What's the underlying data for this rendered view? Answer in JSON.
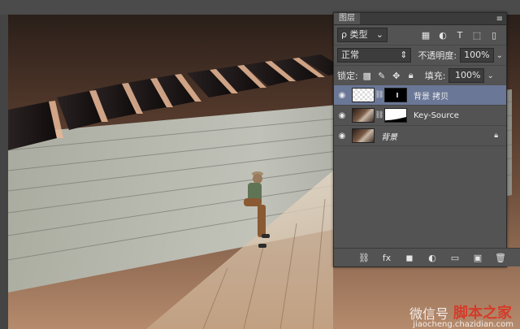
{
  "panel": {
    "tab_label": "图层",
    "menu_glyph": "≡",
    "filter": {
      "kind_label": "ρ 类型"
    },
    "blend": {
      "mode": "正常",
      "opacity_label": "不透明度:",
      "opacity_value": "100%"
    },
    "lock": {
      "label": "锁定:",
      "fill_label": "填充:",
      "fill_value": "100%"
    },
    "layers": [
      {
        "name": "背景 拷贝",
        "active": true
      },
      {
        "name": "Key-Source",
        "active": false
      },
      {
        "name": "背景",
        "active": false
      }
    ]
  },
  "watermark": {
    "left_text": "微信号",
    "right_text": "脚本之家",
    "url": "jiaocheng.chazidian.com"
  }
}
